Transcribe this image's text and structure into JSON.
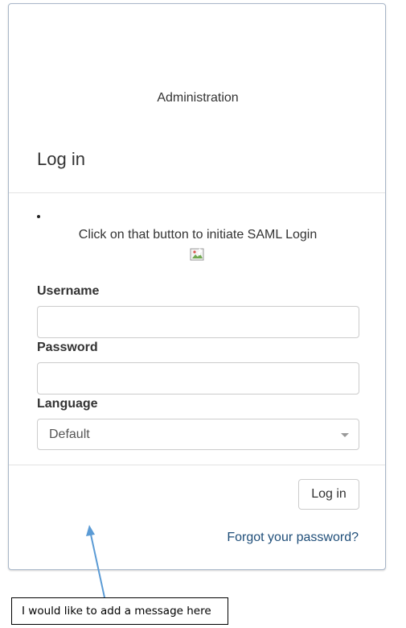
{
  "header": {
    "admin_title": "Administration",
    "page_title": "Log in"
  },
  "saml": {
    "message": "Click on that button to initiate SAML Login",
    "icon": "broken-image-icon"
  },
  "form": {
    "username_label": "Username",
    "username_value": "",
    "password_label": "Password",
    "password_value": "",
    "language_label": "Language",
    "language_selected": "Default"
  },
  "footer": {
    "login_button": "Log in",
    "forgot_password": "Forgot your password?"
  },
  "annotation": {
    "text": "I would like to add a message here",
    "arrow_color": "#5b9bd5"
  },
  "colors": {
    "link": "#1f4e79",
    "border": "#cccccc"
  }
}
